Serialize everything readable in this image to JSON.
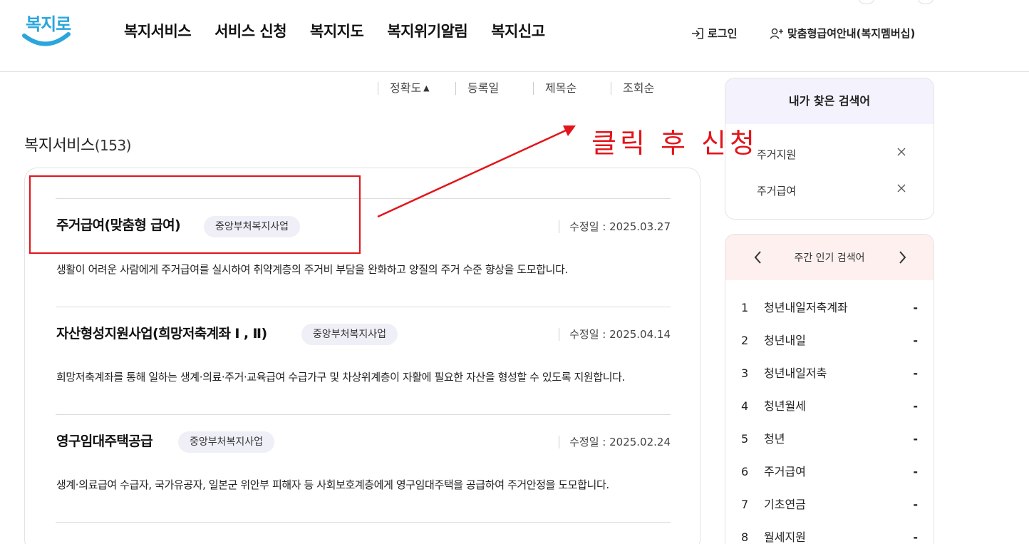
{
  "header": {
    "logo_text": "복지로",
    "nav": [
      "복지서비스",
      "서비스 신청",
      "복지지도",
      "복지위기알림",
      "복지신고"
    ],
    "login_label": "로그인",
    "member_label": "맞춤형급여안내(복지멤버십)"
  },
  "sort": {
    "items": [
      "정확도",
      "등록일",
      "제목순",
      "조회순"
    ],
    "active_indicator": "▲"
  },
  "section": {
    "title": "복지서비스",
    "count": "(153)"
  },
  "results": [
    {
      "title": "주거급여(맞춤형 급여)",
      "badge": "중앙부처복지사업",
      "date_label": "수정일",
      "date_value": "2025.03.27",
      "desc": "생활이 어려운 사람에게 주거급여를 실시하여 취약계층의 주거비 부담을 완화하고 양질의 주거 수준 향상을 도모합니다."
    },
    {
      "title": "자산형성지원사업(희망저축계좌 Ⅰ , Ⅱ)",
      "badge": "중앙부처복지사업",
      "date_label": "수정일",
      "date_value": "2025.04.14",
      "desc": "희망저축계좌를 통해 일하는 생계·의료·주거·교육급여 수급가구 및 차상위계층이 자활에 필요한 자산을 형성할 수 있도록 지원합니다."
    },
    {
      "title": "영구임대주택공급",
      "badge": "중앙부처복지사업",
      "date_label": "수정일",
      "date_value": "2025.02.24",
      "desc": "생계·의료급여 수급자, 국가유공자, 일본군 위안부 피해자 등 사회보호계층에게 영구임대주택을 공급하여 주거안정을 도모합니다."
    }
  ],
  "my_search": {
    "title": "내가 찾은 검색어",
    "keywords": [
      "주거지원",
      "주거급여"
    ]
  },
  "popular": {
    "title": "주간 인기 검색어",
    "items": [
      {
        "rank": "1",
        "keyword": "청년내일저축계좌",
        "change": "-"
      },
      {
        "rank": "2",
        "keyword": "청년내일",
        "change": "-"
      },
      {
        "rank": "3",
        "keyword": "청년내일저축",
        "change": "-"
      },
      {
        "rank": "4",
        "keyword": "청년월세",
        "change": "-"
      },
      {
        "rank": "5",
        "keyword": "청년",
        "change": "-"
      },
      {
        "rank": "6",
        "keyword": "주거급여",
        "change": "-"
      },
      {
        "rank": "7",
        "keyword": "기초연금",
        "change": "-"
      },
      {
        "rank": "8",
        "keyword": "월세지원",
        "change": "-"
      }
    ]
  },
  "annotation": {
    "text": "클릭 후 신청",
    "color": "#e2151b"
  },
  "colors": {
    "logo_blue": "#2aa6dd",
    "badge_bg": "#efeff8",
    "search_head_bg": "#f3f2fd",
    "popular_head_bg": "#fdf0ef"
  }
}
